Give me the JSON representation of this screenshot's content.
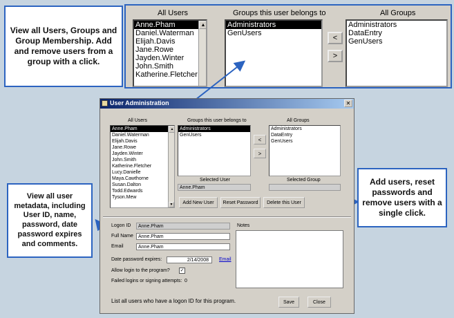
{
  "callouts": {
    "groups": "View all Users, Groups and Group Membership. Add and remove users from a group with a click.",
    "metadata": "View all user metadata, including User ID, name, password, date password expires and comments.",
    "actions": "Add users, reset passwords and remove users with a single click."
  },
  "zoom": {
    "all_users_label": "All Users",
    "groups_belong_label": "Groups this user belongs to",
    "all_groups_label": "All Groups",
    "users": [
      "Anne.Pham",
      "Daniel.Waterman",
      "Elijah.Davis",
      "Jane.Rowe",
      "Jayden.Winter",
      "John.Smith",
      "Katherine.Fletcher"
    ],
    "member_groups": [
      "Administrators",
      "GenUsers"
    ],
    "all_groups": [
      "Administrators",
      "DataEntry",
      "GenUsers"
    ],
    "remove_btn": "<",
    "add_btn": ">"
  },
  "window": {
    "title": "User Administration",
    "close_glyph": "✕",
    "all_users_label": "All Users",
    "groups_belong_label": "Groups this user belongs to",
    "all_groups_label": "All Groups",
    "users": [
      "Anne.Pham",
      "Daniel.Waterman",
      "Elijah.Davis",
      "Jane.Rowe",
      "Jayden.Winter",
      "John.Smith",
      "Katherine.Fletcher",
      "Lucy.Danielle",
      "Maya.Cawthorne",
      "Susan.Dalton",
      "Todd.Edwards",
      "Tyson.Mew"
    ],
    "member_groups": [
      "Administrators",
      "GenUsers"
    ],
    "all_groups": [
      "Administrators",
      "DataEntry",
      "GenUsers"
    ],
    "remove_btn": "<",
    "add_btn": ">",
    "selected_user_label": "Selected User",
    "selected_user_value": "Anne.Pham",
    "selected_group_label": "Selected Group",
    "selected_group_value": "",
    "add_user_btn": "Add New User",
    "reset_pw_btn": "Reset Password",
    "delete_user_btn": "Delete this User",
    "logon_id_label": "Logon ID",
    "logon_id_value": "Anne.Pham",
    "full_name_label": "Full Name",
    "full_name_value": "Anne.Pham",
    "email_label": "Email",
    "email_value": "Anne.Pham",
    "date_expires_label": "Date password expires:",
    "date_expires_value": "2/14/2008",
    "email_link": "Email",
    "allow_login_label": "Allow login to the program?",
    "allow_login_checked": true,
    "failed_logins_label": "Failed logins or signing attempts:",
    "failed_logins_value": "0",
    "notes_label": "Notes",
    "footer_text": "List all users who have a logon ID for this program.",
    "save_btn": "Save",
    "close_btn": "Close"
  },
  "colors": {
    "accent_blue": "#2b63c0",
    "title_bar": "#0a246a"
  }
}
